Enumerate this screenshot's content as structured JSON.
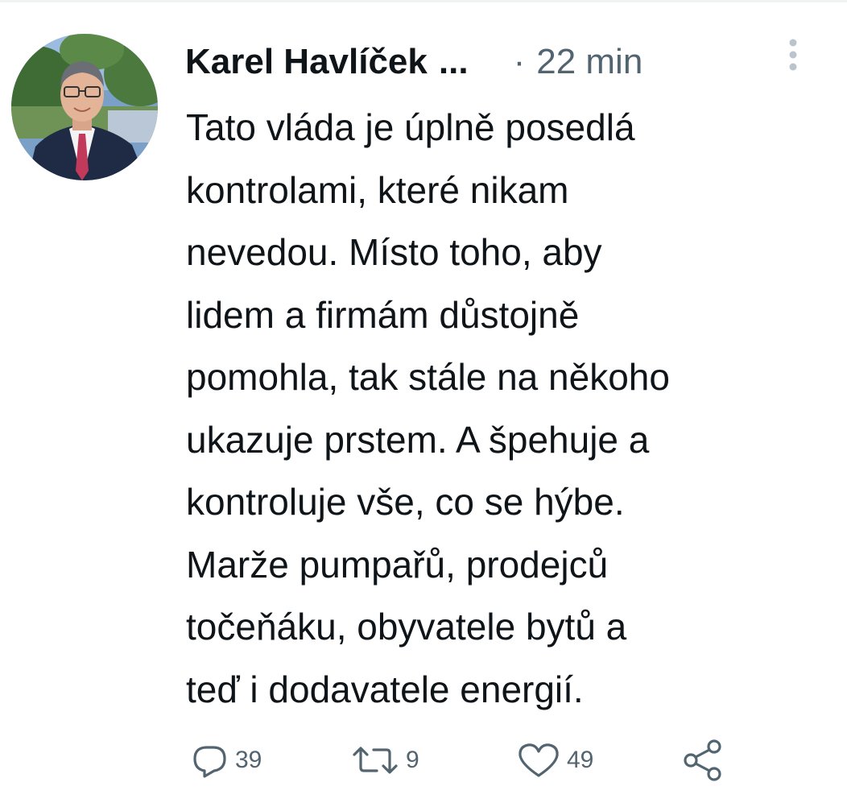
{
  "tweet": {
    "author_name": "Karel Havlíček",
    "name_ellipsis": "...",
    "separator": "·",
    "timestamp": "22 min",
    "text_lines": [
      "Tato vláda je úplně posedlá",
      "kontrolami, které nikam",
      "nevedou. Místo toho, aby",
      "lidem a firmám důstojně",
      "pomohla, tak stále na někoho",
      "ukazuje prstem. A špehuje a",
      "kontroluje vše, co se hýbe.",
      "Marže pumpařů, prodejců",
      "točeňáku, obyvatele bytů a",
      "teď i dodavatele energií."
    ],
    "actions": {
      "reply_count": "39",
      "retweet_count": "9",
      "like_count": "49"
    }
  },
  "icons": {
    "more": "more-vertical-icon",
    "reply": "reply-icon",
    "retweet": "retweet-icon",
    "like": "heart-icon",
    "share": "share-icon"
  },
  "colors": {
    "text_primary": "#0f1419",
    "text_secondary": "#536471",
    "more_dots": "#b9c4cc"
  }
}
